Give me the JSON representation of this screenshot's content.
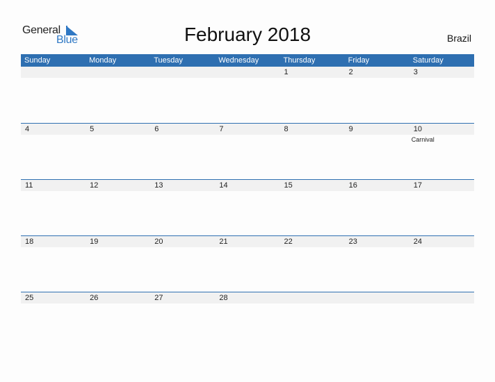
{
  "logo": {
    "word1": "General",
    "word2": "Blue"
  },
  "title": "February 2018",
  "country": "Brazil",
  "colors": {
    "accent": "#2e6fb1",
    "strip": "#f1f1f1"
  },
  "weekdays": [
    "Sunday",
    "Monday",
    "Tuesday",
    "Wednesday",
    "Thursday",
    "Friday",
    "Saturday"
  ],
  "weeks": [
    [
      {
        "day": ""
      },
      {
        "day": ""
      },
      {
        "day": ""
      },
      {
        "day": ""
      },
      {
        "day": "1"
      },
      {
        "day": "2"
      },
      {
        "day": "3"
      }
    ],
    [
      {
        "day": "4"
      },
      {
        "day": "5"
      },
      {
        "day": "6"
      },
      {
        "day": "7"
      },
      {
        "day": "8"
      },
      {
        "day": "9"
      },
      {
        "day": "10",
        "event": "Carnival"
      }
    ],
    [
      {
        "day": "11"
      },
      {
        "day": "12"
      },
      {
        "day": "13"
      },
      {
        "day": "14"
      },
      {
        "day": "15"
      },
      {
        "day": "16"
      },
      {
        "day": "17"
      }
    ],
    [
      {
        "day": "18"
      },
      {
        "day": "19"
      },
      {
        "day": "20"
      },
      {
        "day": "21"
      },
      {
        "day": "22"
      },
      {
        "day": "23"
      },
      {
        "day": "24"
      }
    ],
    [
      {
        "day": "25"
      },
      {
        "day": "26"
      },
      {
        "day": "27"
      },
      {
        "day": "28"
      },
      {
        "day": ""
      },
      {
        "day": ""
      },
      {
        "day": ""
      }
    ]
  ]
}
